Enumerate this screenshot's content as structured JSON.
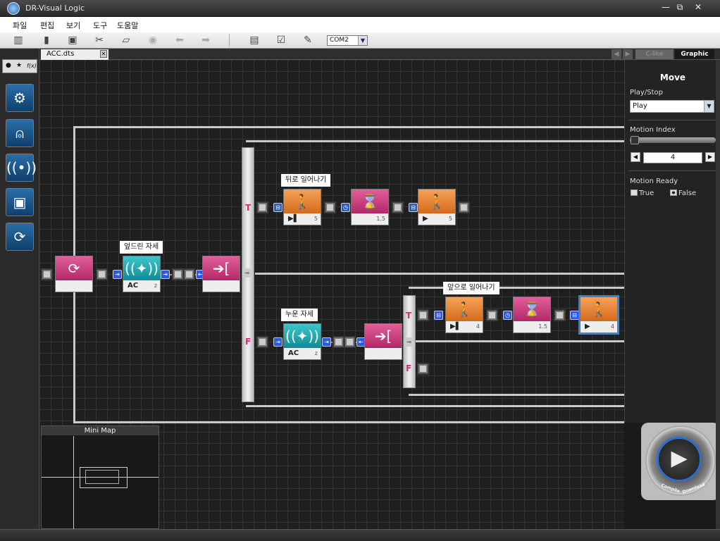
{
  "window": {
    "title": "DR-Visual Logic",
    "buttons": [
      "—",
      "⧉",
      "✕"
    ]
  },
  "menu": [
    "파일",
    "편집",
    "보기",
    "도구",
    "도움말"
  ],
  "toolbar": {
    "port": "COM2"
  },
  "left_panel": {
    "tabs": [
      "●",
      "★",
      "f(x)"
    ],
    "tools": [
      "gear-icon",
      "antenna-icon",
      "wireless-icon",
      "save-icon",
      "cycle-icon"
    ]
  },
  "document": {
    "tab": "ACC.dts",
    "close": "✕",
    "view_tabs": [
      "C-like",
      "Graphic"
    ],
    "nav": [
      "◀",
      "▶"
    ]
  },
  "diagram": {
    "labels": {
      "fallen": "엎드린 자세",
      "back_rise": "뒤로 일어나기",
      "lying": "누운 자세",
      "front_rise": "앞으로 일어나기"
    },
    "blocks": {
      "ac1": {
        "key": "AC",
        "value": "z"
      },
      "ac2": {
        "key": "AC",
        "value": "z"
      },
      "m1": {
        "value": "5"
      },
      "w1": {
        "value": "1.5"
      },
      "m2": {
        "value": "5"
      },
      "m3": {
        "value": "4"
      },
      "w2": {
        "value": "1.5"
      },
      "m4": {
        "value": "4"
      }
    },
    "branch": {
      "t": "T",
      "f": "F"
    }
  },
  "minimap": {
    "title": "Mini Map"
  },
  "properties": {
    "title": "Move",
    "play_stop_label": "Play/Stop",
    "play_stop_value": "Play",
    "motion_index_label": "Motion Index",
    "motion_index_value": "4",
    "motion_index_fraction": 0.0,
    "motion_ready_label": "Motion Ready",
    "true_label": "True",
    "false_label": "False",
    "selected": "False"
  },
  "play_button": {
    "left_caption": "Compile",
    "right_caption": "Download"
  },
  "colors": {
    "motion": "#e07a2a",
    "wait": "#c02a6e",
    "sensor": "#15a0aa",
    "selection": "#3b82d6"
  }
}
